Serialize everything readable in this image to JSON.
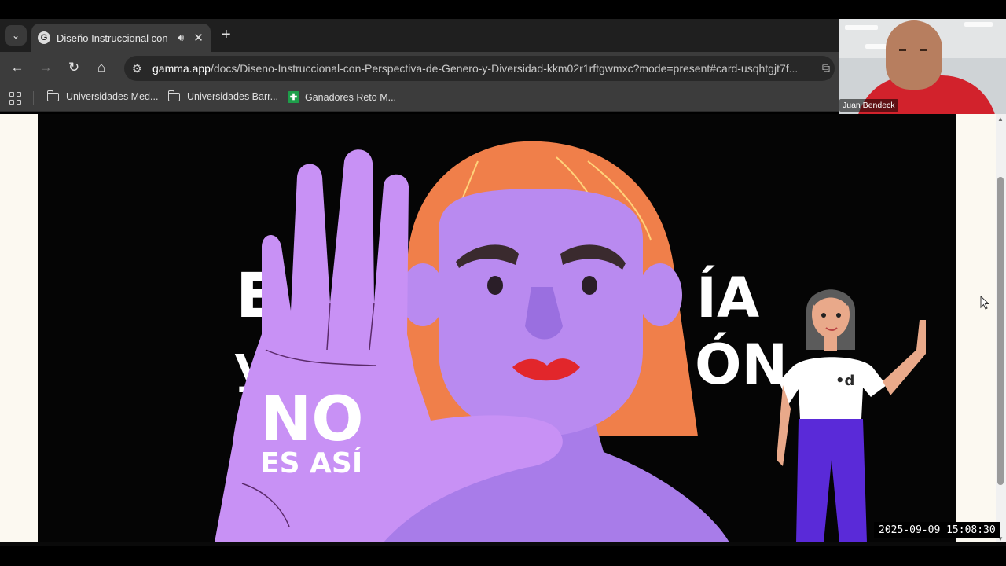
{
  "browser": {
    "tab_title": "Diseño Instruccional con Pe",
    "favicon_letter": "G",
    "url_host": "gamma.app",
    "url_path": "/docs/Diseno-Instruccional-con-Perspectiva-de-Genero-y-Diversidad-kkm02r1rftgwmxc?mode=present#card-usqhtgjt7f...",
    "bookmarks": [
      {
        "label": "Universidades Med...",
        "icon": "folder-icon"
      },
      {
        "label": "Universidades Barr...",
        "icon": "folder-icon"
      },
      {
        "label": "Ganadores Reto M...",
        "icon": "sheets-icon"
      }
    ]
  },
  "webcam": {
    "participant_name": "Juan Bendeck"
  },
  "slide": {
    "hand_text_line1": "NO",
    "hand_text_line2": "ES ASÍ",
    "partial_text_right_1": "ÍA",
    "partial_text_right_2": "ÓN",
    "partial_text_left_1": "E",
    "partial_text_left_2": "y",
    "shirt_logo": "•d"
  },
  "video": {
    "timestamp": "2025-09-09 15:08:30"
  },
  "colors": {
    "hand": "#c891f5",
    "face": "#b98af0",
    "hair": "#f07f4a",
    "lips": "#e2262b",
    "pants": "#5a2ad8",
    "page_bg": "#fcf9f1",
    "progress": "#3d8fd6"
  }
}
